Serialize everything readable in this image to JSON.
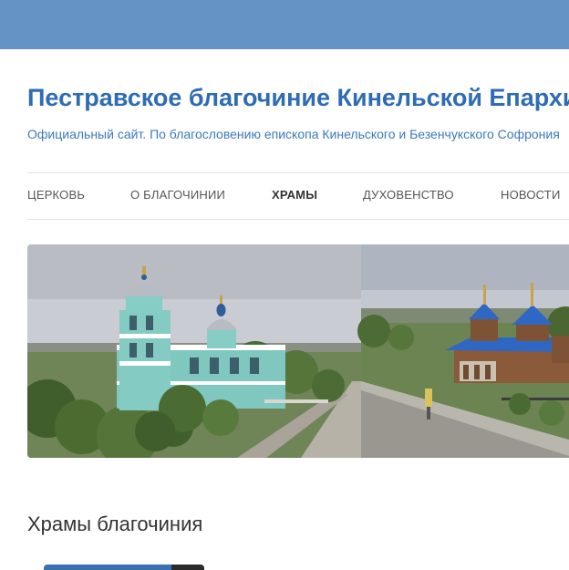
{
  "site": {
    "title": "Пестравское благочиние Кинельской Епархии",
    "subtitle": "Официальный сайт. По благословению епископа Кинельского и Безенчукского Софрония"
  },
  "nav": {
    "items": [
      {
        "label": "ЦЕРКОВЬ",
        "active": false
      },
      {
        "label": "О БЛАГОЧИНИИ",
        "active": false
      },
      {
        "label": "ХРАМЫ",
        "active": true
      },
      {
        "label": "ДУХОВЕНСТВО",
        "active": false
      },
      {
        "label": "НОВОСТИ",
        "active": false
      }
    ]
  },
  "banner": {
    "images": [
      {
        "name": "church-photo-turquoise"
      },
      {
        "name": "church-photo-blue-domes"
      }
    ]
  },
  "main": {
    "section_title": "Храмы благочиния"
  },
  "colors": {
    "header_bar": "#6593c5",
    "title_blue": "#2f6cb3",
    "nav_text": "#555555"
  }
}
